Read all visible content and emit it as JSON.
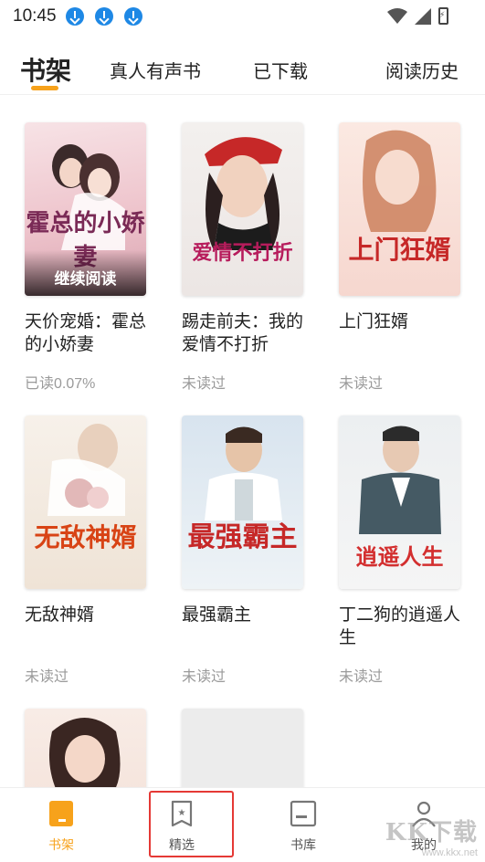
{
  "status_bar": {
    "time": "10:45",
    "notification_icons": [
      "download-icon",
      "download-icon",
      "download-icon"
    ],
    "right_icons": [
      "wifi-icon",
      "signal-icon",
      "battery-charging-icon"
    ]
  },
  "tabs": [
    {
      "label": "书架",
      "active": true
    },
    {
      "label": "真人有声书",
      "active": false
    },
    {
      "label": "已下载",
      "active": false
    },
    {
      "label": "阅读历史",
      "active": false
    }
  ],
  "accent_color": "#f7a21b",
  "books": [
    {
      "title": "天价宠婚：霍总的小娇妻",
      "progress": "已读0.07%",
      "cover_text": "霍总的小娇妻",
      "overlay": "继续阅读"
    },
    {
      "title": "踢走前夫：我的爱情不打折",
      "progress": "未读过",
      "cover_text": "爱情不打折"
    },
    {
      "title": "上门狂婿",
      "progress": "未读过",
      "cover_text": "上门狂婿"
    },
    {
      "title": "无敌神婿",
      "progress": "未读过",
      "cover_text": "无敌神婿"
    },
    {
      "title": "最强霸主",
      "progress": "未读过",
      "cover_text": "最强霸主"
    },
    {
      "title": "丁二狗的逍遥人生",
      "progress": "未读过",
      "cover_text": "逍遥人生"
    },
    {
      "title": "",
      "progress": "",
      "cover_text": ""
    },
    {
      "title": "",
      "progress": "",
      "cover_text": ""
    }
  ],
  "bottom_nav": [
    {
      "label": "书架",
      "icon": "bookshelf-icon",
      "active": true
    },
    {
      "label": "精选",
      "icon": "featured-badge-icon",
      "active": false
    },
    {
      "label": "书库",
      "icon": "library-icon",
      "active": false
    },
    {
      "label": "我的",
      "icon": "profile-icon",
      "active": false
    }
  ],
  "watermark": {
    "logo": "KK下载",
    "url": "www.kkx.net"
  }
}
